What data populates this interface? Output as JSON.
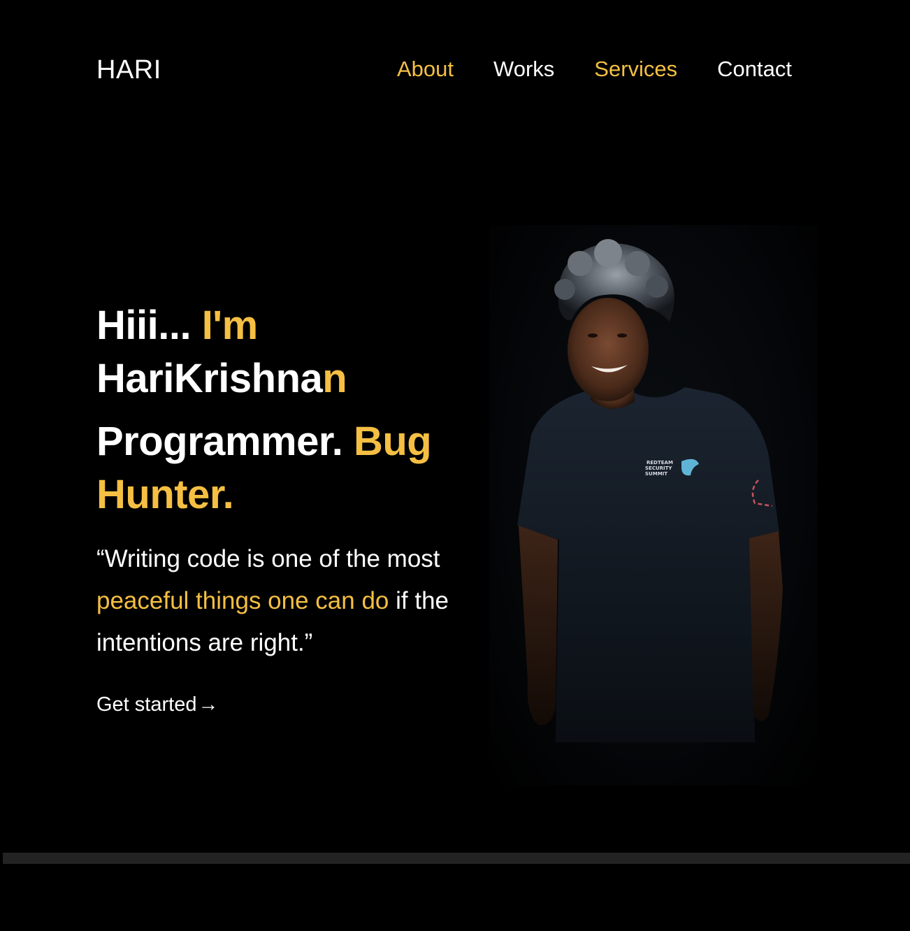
{
  "header": {
    "logo": "HARI",
    "nav": [
      {
        "label": "About",
        "accent": true
      },
      {
        "label": "Works",
        "accent": false
      },
      {
        "label": "Services",
        "accent": true
      },
      {
        "label": "Contact",
        "accent": false
      }
    ]
  },
  "hero": {
    "greeting_part1": "Hiii... ",
    "greeting_part2": "I'm",
    "name_part1": "HariKrishna",
    "name_part2": "n",
    "role_part1": "Programmer. ",
    "role_part2": "Bug Hunter.",
    "quote_part1": "“Writing code is one of the most ",
    "quote_part2": "peaceful things one can do",
    "quote_part3": " if the intentions are right.”",
    "cta_label": "Get started",
    "cta_arrow": "→"
  },
  "photo": {
    "shirt_text_line1": "REDTEAM",
    "shirt_text_line2": "SECURITY",
    "shirt_text_line3": "SUMMIT"
  },
  "colors": {
    "accent": "#f5bf43",
    "background": "#000000",
    "text": "#ffffff"
  }
}
